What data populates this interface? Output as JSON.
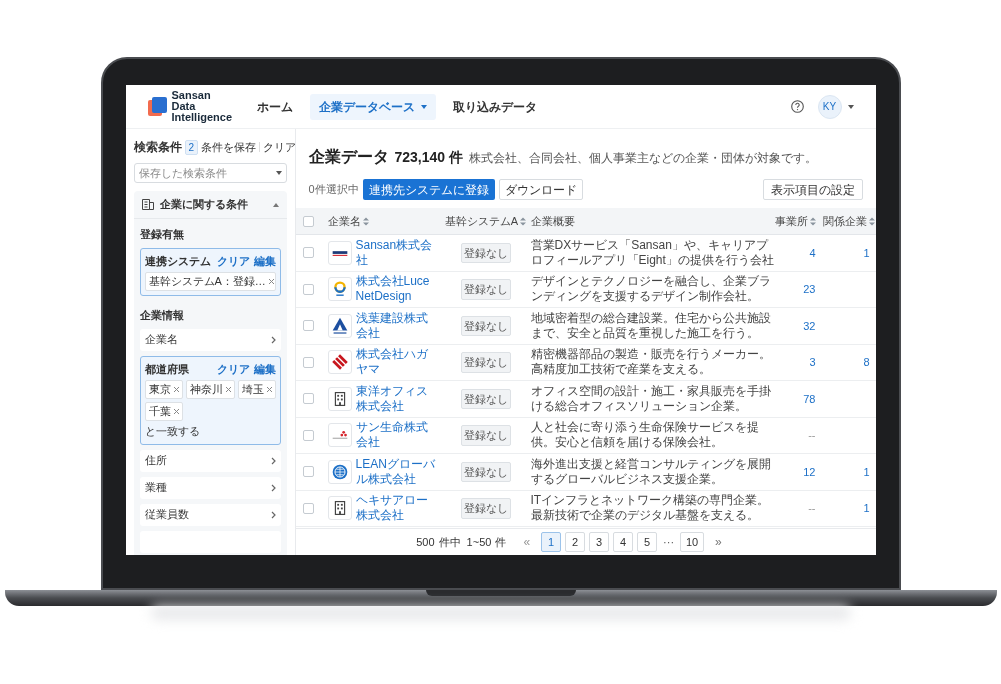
{
  "header": {
    "logo_lines": [
      "Sansan",
      "Data",
      "Intelligence"
    ],
    "nav": [
      {
        "label": "ホーム",
        "selected": false,
        "dropdown": false
      },
      {
        "label": "企業データベース",
        "selected": true,
        "dropdown": true
      },
      {
        "label": "取り込みデータ",
        "selected": false,
        "dropdown": false
      }
    ],
    "avatar": "KY"
  },
  "sidebar": {
    "title": "検索条件",
    "count": "2",
    "save": "条件を保存",
    "clear": "クリア",
    "saved_select": {
      "placeholder": "保存した検索条件"
    },
    "section": {
      "title": "企業に関する条件",
      "expanded": true
    },
    "groups": [
      {
        "title": "登録有無",
        "filters": [
          {
            "kind": "active",
            "title": "連携システム",
            "clear": "クリア",
            "edit": "編集",
            "chips": [
              "基幹システムA：登録…"
            ]
          }
        ]
      },
      {
        "title": "企業情報",
        "filters": [
          {
            "kind": "row",
            "title": "企業名"
          },
          {
            "kind": "active",
            "title": "都道府県",
            "clear": "クリア",
            "edit": "編集",
            "chips": [
              "東京",
              "神奈川",
              "埼玉",
              "千葉"
            ],
            "note": "と一致する"
          },
          {
            "kind": "row",
            "title": "住所"
          },
          {
            "kind": "row",
            "title": "業種"
          },
          {
            "kind": "row",
            "title": "従業員数"
          },
          {
            "kind": "row"
          }
        ]
      }
    ]
  },
  "main": {
    "title": "企業データ",
    "count": "723,140 件",
    "description": "株式会社、合同会社、個人事業主などの企業・団体が対象です。",
    "selected_count": "0件選択中",
    "register_button": "連携先システムに登録",
    "download_button": "ダウンロード",
    "columns_button": "表示項目の設定",
    "table": {
      "select_all": {
        "checked": false
      },
      "columns": [
        {
          "label": "企業名",
          "sortable": true
        },
        {
          "label": "基幹システムA",
          "sortable": true
        },
        {
          "label": "企業概要",
          "sortable": false
        },
        {
          "label": "事業所",
          "sortable": true
        },
        {
          "label": "関係企業",
          "sortable": true
        }
      ],
      "rows": [
        {
          "checked": false,
          "name": "Sansan株式会社",
          "system": "登録なし",
          "summary": [
            "営業DXサービス「Sansan」や、キャリアプ",
            "ロフィールアプリ「Eight」の提供を行う会社"
          ],
          "offices": "4",
          "related": "1"
        },
        {
          "checked": false,
          "name": "株式会社LuceNetDesign",
          "system": "登録なし",
          "summary": [
            "デザインとテクノロジーを融合し、企業ブラ",
            "ンディングを支援するデザイン制作会社。"
          ],
          "offices": "23"
        },
        {
          "checked": false,
          "name": "浅葉建設株式会社",
          "system": "登録なし",
          "summary": [
            "地域密着型の総合建設業。住宅から公共施設",
            "まで、安全と品質を重視した施工を行う。"
          ],
          "offices": "32"
        },
        {
          "checked": false,
          "name": "株式会社ハガヤマ",
          "system": "登録なし",
          "summary": [
            "精密機器部品の製造・販売を行うメーカー。",
            "高精度加工技術で産業を支える。"
          ],
          "offices": "3",
          "related": "8"
        },
        {
          "checked": false,
          "name": "東洋オフィス株式会社",
          "system": "登録なし",
          "summary": [
            "オフィス空間の設計・施工・家具販売を手掛",
            "ける総合オフィスソリューション企業。"
          ],
          "offices": "78"
        },
        {
          "checked": false,
          "name": "サン生命株式会社",
          "system": "登録なし",
          "summary": [
            "人と社会に寄り添う生命保険サービスを提",
            "供。安心と信頼を届ける保険会社。"
          ],
          "offices": "--"
        },
        {
          "checked": false,
          "name": "LEANグローバル株式会社",
          "system": "登録なし",
          "summary": [
            "海外進出支援と経営コンサルティングを展開",
            "するグローバルビジネス支援企業。"
          ],
          "offices": "12",
          "related": "1"
        },
        {
          "checked": false,
          "name": "ヘキサアロー株式会社",
          "system": "登録なし",
          "summary": [
            "ITインフラとネットワーク構築の専門企業。",
            "最新技術で企業のデジタル基盤を支える。"
          ],
          "offices": "--",
          "related": "1"
        }
      ]
    },
    "pagination": {
      "total": "500",
      "total_unit": "件中",
      "range": "1~50",
      "range_unit": "件",
      "first": "«",
      "pages": [
        {
          "label": "1",
          "selected": true
        },
        {
          "label": "2",
          "selected": false
        },
        {
          "label": "3",
          "selected": false
        },
        {
          "label": "4",
          "selected": false
        },
        {
          "label": "5",
          "selected": false
        }
      ],
      "ellipsis": "···",
      "last_page": {
        "label": "10",
        "selected": false
      },
      "last": "»"
    }
  }
}
